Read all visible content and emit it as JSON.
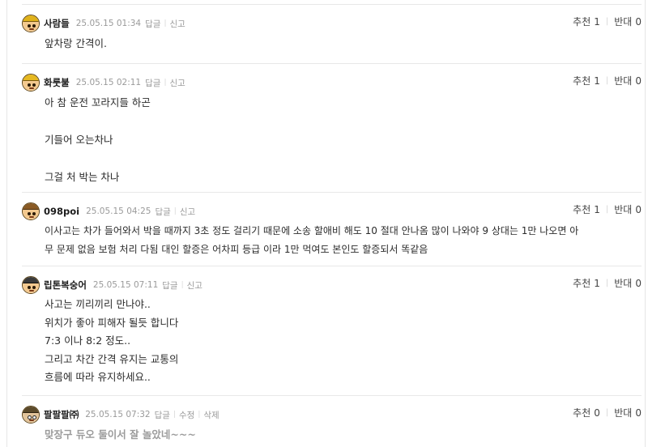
{
  "comments": [
    {
      "nick": "사람들",
      "date": "25.05.15 01:34",
      "actions": [
        "답글",
        "신고"
      ],
      "upvote_label": "추천",
      "upvotes": "1",
      "downvote_label": "반대",
      "downvotes": "0",
      "lines": [
        "앞차랑 간격이."
      ],
      "avatar_icon": "yellow-helmet-icon"
    },
    {
      "nick": "화룻불",
      "date": "25.05.15 02:11",
      "actions": [
        "답글",
        "신고"
      ],
      "upvote_label": "추천",
      "upvotes": "1",
      "downvote_label": "반대",
      "downvotes": "0",
      "lines": [
        "아 참 운전 꼬라지들 하곤",
        "",
        "기들어 오는차나",
        "",
        "그걸 처 박는 차나"
      ],
      "avatar_icon": "yellow-helmet-icon"
    },
    {
      "nick": "098poi",
      "date": "25.05.15 04:25",
      "actions": [
        "답글",
        "신고"
      ],
      "upvote_label": "추천",
      "upvotes": "1",
      "downvote_label": "반대",
      "downvotes": "0",
      "lines": [
        "이사고는 차가 들어와서 박을 때까지 3초 정도 걸리기 때문에 소송 할애비 해도 10 절대 안나옴 많이 나와야 9 상대는 1만 나오면 아",
        "무 문제 없음 보험 처리 다됨 대인 할증은 어차피 등급 이라 1만 먹여도 본인도 할증되서 똑같음"
      ],
      "avatar_icon": "brown-cap-icon"
    },
    {
      "nick": "립톤복숭어",
      "date": "25.05.15 07:11",
      "actions": [
        "답글",
        "신고"
      ],
      "upvote_label": "추천",
      "upvotes": "1",
      "downvote_label": "반대",
      "downvotes": "0",
      "lines": [
        "사고는 끼리끼리 만나야..",
        "위치가 좋아 피해자 될듯 합니다",
        "7:3 이나 8:2 정도..",
        "그리고 차간 간격 유지는 교통의",
        "흐름에 따라 유지하세요.."
      ],
      "avatar_icon": "dark-helmet-icon"
    },
    {
      "nick": "팔팔팔㈜",
      "date": "25.05.15 07:32",
      "actions": [
        "답글",
        "수정",
        "삭제"
      ],
      "upvote_label": "추천",
      "upvotes": "0",
      "downvote_label": "반대",
      "downvotes": "0",
      "lines": [
        "맞장구 듀오 둘이서 잘 놀았네~~~"
      ],
      "avatar_icon": "glasses-face-icon"
    }
  ],
  "colors": {
    "text": "#2b2b2b",
    "meta": "#9a9a9a",
    "divider": "#e8e8e8",
    "muted_text": "#9b9b9b"
  }
}
